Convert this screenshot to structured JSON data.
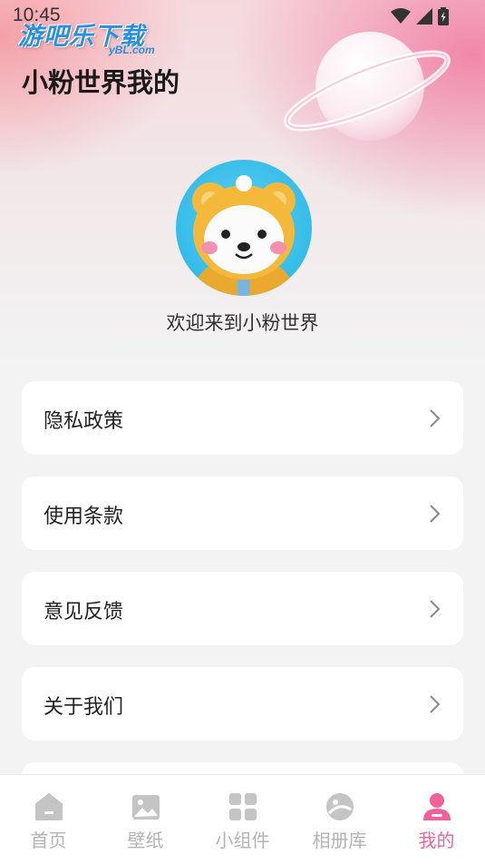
{
  "status_bar": {
    "time": "10:45"
  },
  "watermark": {
    "main": "游吧乐下载",
    "sub": "yBL.com"
  },
  "header": {
    "title": "小粉世界我的"
  },
  "profile": {
    "welcome": "欢迎来到小粉世界"
  },
  "menu": [
    {
      "label": "隐私政策"
    },
    {
      "label": "使用条款"
    },
    {
      "label": "意见反馈"
    },
    {
      "label": "关于我们"
    }
  ],
  "bottom_nav": [
    {
      "label": "首页",
      "icon": "home-icon"
    },
    {
      "label": "壁纸",
      "icon": "image-icon"
    },
    {
      "label": "小组件",
      "icon": "widgets-icon"
    },
    {
      "label": "相册库",
      "icon": "album-icon"
    },
    {
      "label": "我的",
      "icon": "person-icon",
      "active": true
    }
  ],
  "colors": {
    "accent": "#f0609a",
    "inactive": "#b3b3b3"
  }
}
